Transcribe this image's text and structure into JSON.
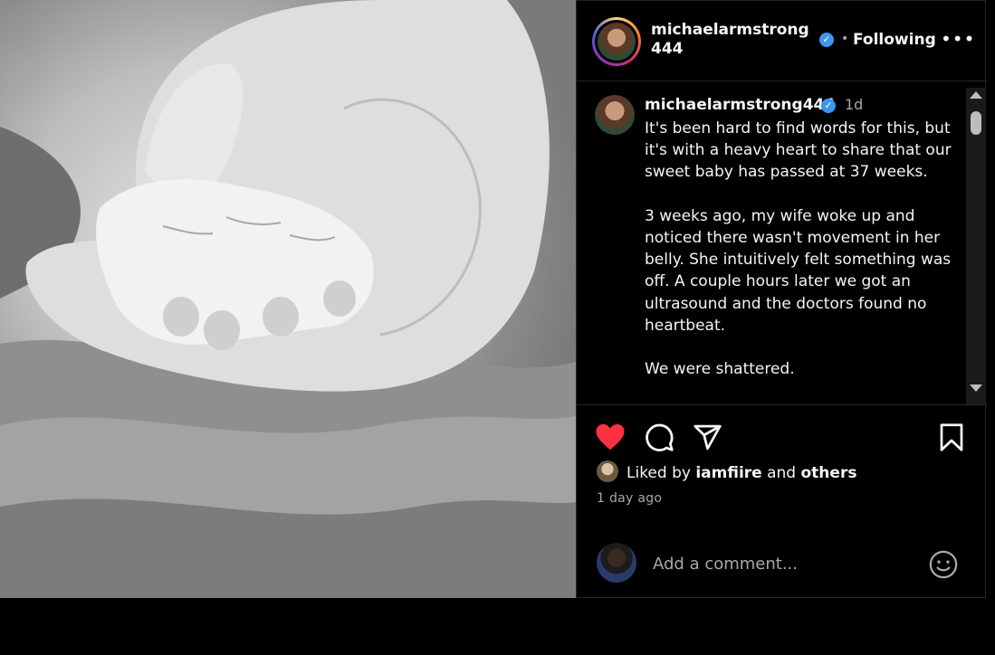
{
  "post": {
    "username": "michaelarmstrong444",
    "follow_state": "Following",
    "dot": "•",
    "more": "•••"
  },
  "caption": {
    "username": "michaelarmstrong444",
    "time": "1d",
    "text": "It's been hard to find words for this, but it's with a heavy heart to share that our sweet baby has passed at 37 weeks.\n\n3 weeks ago, my wife woke up and noticed there wasn't movement in her belly. She intuitively felt something was off. A couple hours later we got an ultrasound and the doctors found no heartbeat.\n\nWe were shattered."
  },
  "likes": {
    "prefix": "Liked by ",
    "user": "iamfiire",
    "middle": " and ",
    "others": "others"
  },
  "timestamp": "1 day ago",
  "comment": {
    "placeholder": "Add a comment..."
  },
  "icons": {
    "like": "heart-icon",
    "comment": "comment-icon",
    "share": "share-icon",
    "save": "bookmark-icon",
    "emoji": "emoji-icon",
    "verified": "verified-badge-icon",
    "more": "more-options-icon"
  },
  "colors": {
    "like_red": "#ff3040",
    "verified_blue": "#3897f0",
    "secondary_text": "#a8a8a8"
  }
}
